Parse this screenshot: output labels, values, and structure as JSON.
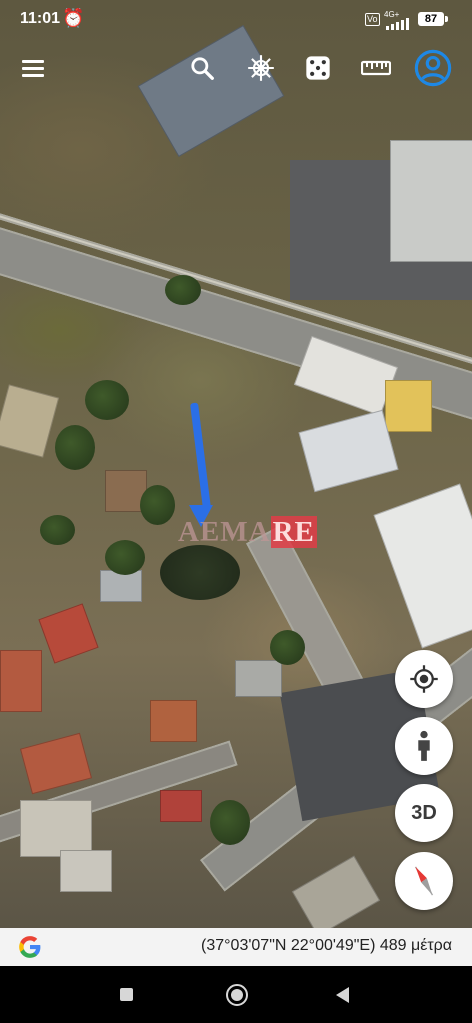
{
  "status_bar": {
    "time": "11:01",
    "alarm_icon": "alarm-clock-icon",
    "network_label": "Vo",
    "lte_label": "4G+",
    "battery_level": "87"
  },
  "toolbar": {
    "menu_icon": "hamburger-menu-icon",
    "search_icon": "search-icon",
    "wheel_icon": "ship-wheel-icon",
    "dice_icon": "dice-icon",
    "ruler_icon": "ruler-icon",
    "account_icon": "account-circle-icon"
  },
  "map": {
    "watermark_left": "ΑΕΜΑ",
    "watermark_highlight": "RE",
    "pin_color": "#2b6fe6"
  },
  "controls": {
    "location_icon": "my-location-icon",
    "streetview_icon": "person-pegman-icon",
    "view_3d_label": "3D",
    "compass_icon": "compass-icon"
  },
  "info_bar": {
    "logo_icon": "google-g-icon",
    "coordinates": "(37°03'07\"N 22°00'49\"E) 489 μέτρα"
  },
  "nav_bar": {
    "recent_icon": "recent-apps-icon",
    "home_icon": "home-icon",
    "back_icon": "back-icon"
  },
  "colors": {
    "accent_blue": "#2b6fe6",
    "account_blue": "#1e88e5"
  }
}
